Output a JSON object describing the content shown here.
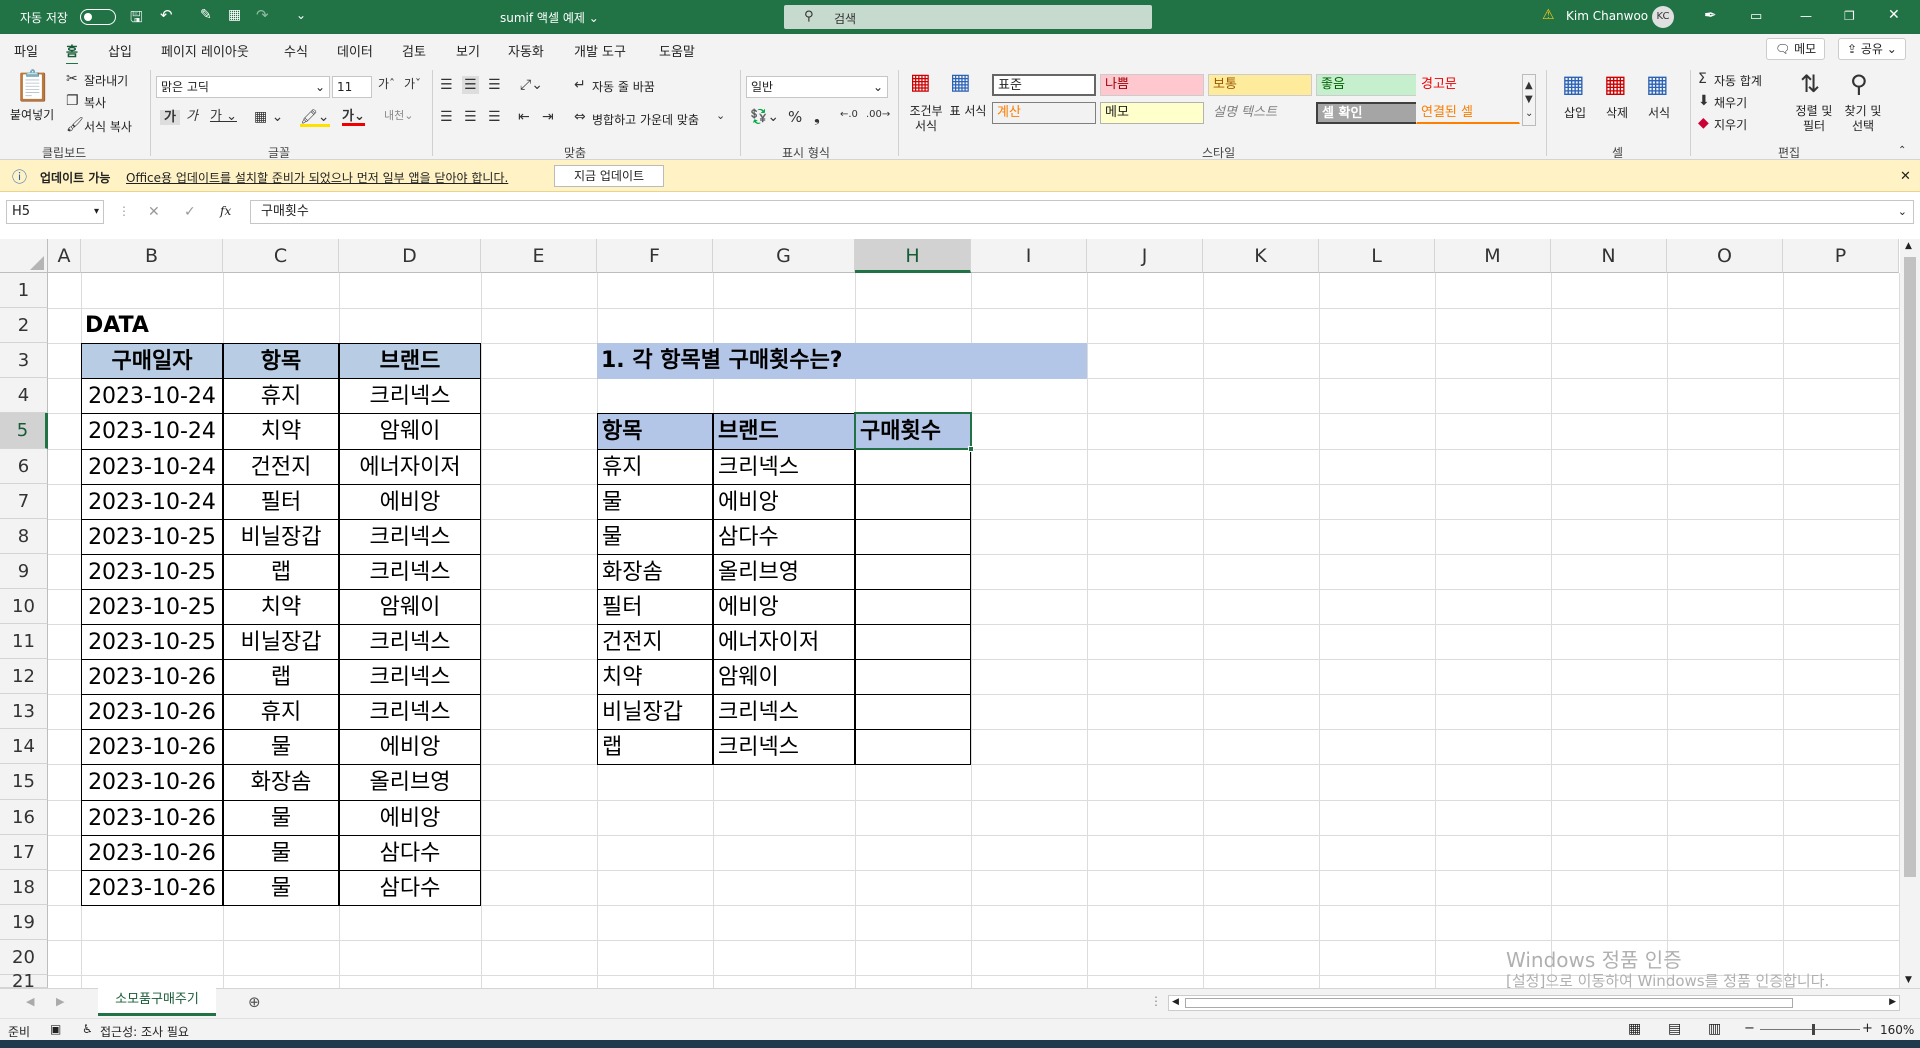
{
  "titlebar": {
    "autosave": "자동 저장",
    "title": "sumif 액셀 예제 ⌄",
    "search": "검색",
    "user": "Kim Chanwoo",
    "initials": "KC"
  },
  "menu": {
    "tabs": [
      "파일",
      "홈",
      "삽입",
      "페이지 레이아웃",
      "수식",
      "데이터",
      "검토",
      "보기",
      "자동화",
      "개발 도구",
      "도움말"
    ],
    "memo": "메모",
    "share": "공유"
  },
  "ribbon": {
    "clipboard": {
      "paste": "붙여넣기",
      "cut": "잘라내기",
      "copy": "복사",
      "format_painter": "서식 복사",
      "group": "클립보드"
    },
    "font": {
      "name": "맑은 고딕",
      "size": "11",
      "group": "글꼴"
    },
    "align": {
      "wrap": "자동 줄 바꿈",
      "merge": "병합하고 가운데 맞춤",
      "group": "맞춤"
    },
    "number": {
      "format": "일반",
      "group": "표시 형식"
    },
    "styles": {
      "conditional": "조건부 서식",
      "table": "표 서식",
      "cells": [
        "표준",
        "나쁨",
        "보통",
        "좋음",
        "경고문",
        "계산",
        "메모",
        "설명 텍스트",
        "셀 확인",
        "연결된 셀"
      ],
      "group": "스타일"
    },
    "cellsgroup": {
      "insert": "삽입",
      "delete": "삭제",
      "format": "서식",
      "group": "셀"
    },
    "editing": {
      "autosum": "자동 합계",
      "fill": "채우기",
      "clear": "지우기",
      "sort": "정렬 및 필터",
      "find": "찾기 및 선택",
      "group": "편집"
    }
  },
  "infobar": {
    "title": "업데이트 가능",
    "message": "Office용 업데이트를 설치할 준비가 되었으나 먼저 일부 앱을 닫아야 합니다.",
    "button": "지금 업데이트"
  },
  "formula": {
    "namebox": "H5",
    "fx": "fx",
    "value": "구매횟수"
  },
  "columns": [
    "A",
    "B",
    "C",
    "D",
    "E",
    "F",
    "G",
    "H",
    "I",
    "J",
    "K",
    "L",
    "M",
    "N",
    "O",
    "P"
  ],
  "rows": [
    "1",
    "2",
    "3",
    "4",
    "5",
    "6",
    "7",
    "8",
    "9",
    "10",
    "11",
    "12",
    "13",
    "14",
    "15",
    "16",
    "17",
    "18",
    "19",
    "20",
    "21"
  ],
  "sheet": {
    "data_label": "DATA",
    "data_headers": [
      "구매일자",
      "항목",
      "브랜드"
    ],
    "data_rows": [
      [
        "2023-10-24",
        "휴지",
        "크리넥스"
      ],
      [
        "2023-10-24",
        "치약",
        "암웨이"
      ],
      [
        "2023-10-24",
        "건전지",
        "에너자이저"
      ],
      [
        "2023-10-24",
        "필터",
        "에비앙"
      ],
      [
        "2023-10-25",
        "비닐장갑",
        "크리넥스"
      ],
      [
        "2023-10-25",
        "랩",
        "크리넥스"
      ],
      [
        "2023-10-25",
        "치약",
        "암웨이"
      ],
      [
        "2023-10-25",
        "비닐장갑",
        "크리넥스"
      ],
      [
        "2023-10-26",
        "랩",
        "크리넥스"
      ],
      [
        "2023-10-26",
        "휴지",
        "크리넥스"
      ],
      [
        "2023-10-26",
        "물",
        "에비앙"
      ],
      [
        "2023-10-26",
        "화장솜",
        "올리브영"
      ],
      [
        "2023-10-26",
        "물",
        "에비앙"
      ],
      [
        "2023-10-26",
        "물",
        "삼다수"
      ],
      [
        "2023-10-26",
        "물",
        "삼다수"
      ]
    ],
    "question": "1. 각 항목별 구매횟수는?",
    "summary_headers": [
      "항목",
      "브랜드",
      "구매횟수"
    ],
    "summary_rows": [
      [
        "휴지",
        "크리넥스",
        ""
      ],
      [
        "물",
        "에비앙",
        ""
      ],
      [
        "물",
        "삼다수",
        ""
      ],
      [
        "화장솜",
        "올리브영",
        ""
      ],
      [
        "필터",
        "에비앙",
        ""
      ],
      [
        "건전지",
        "에너자이저",
        ""
      ],
      [
        "치약",
        "암웨이",
        ""
      ],
      [
        "비닐장갑",
        "크리넥스",
        ""
      ],
      [
        "랩",
        "크리넥스",
        ""
      ]
    ]
  },
  "sheettab": "소모품구매주기",
  "status": {
    "ready": "준비",
    "accessibility": "접근성: 조사 필요",
    "zoom": "160%"
  },
  "watermark": {
    "line1": "Windows 정품 인증",
    "line2": "[설정]으로 이동하여 Windows를 정품 인증합니다."
  }
}
